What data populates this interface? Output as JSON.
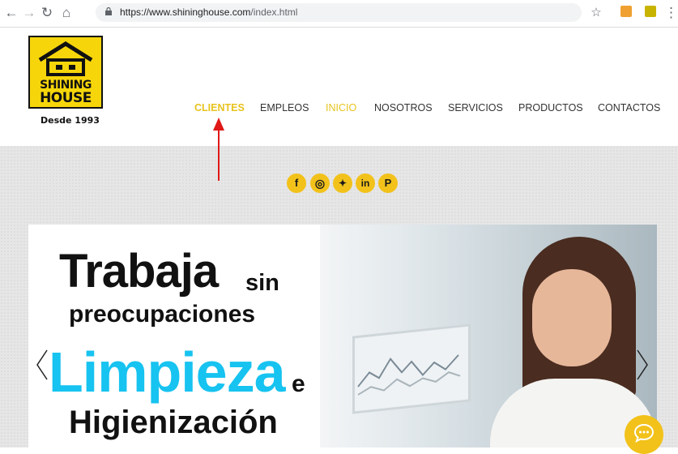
{
  "browser": {
    "url_host": "https://www.shininghouse.com",
    "url_path": "/index.html"
  },
  "logo": {
    "line1": "SHINING",
    "line2": "HOUSE",
    "since": "Desde 1993"
  },
  "nav": {
    "items": [
      {
        "label": "CLIENTES",
        "state": "active-bold"
      },
      {
        "label": "EMPLEOS",
        "state": "normal"
      },
      {
        "label": "INICIO",
        "state": "active"
      },
      {
        "label": "NOSOTROS",
        "state": "normal"
      },
      {
        "label": "SERVICIOS",
        "state": "normal"
      },
      {
        "label": "PRODUCTOS",
        "state": "normal"
      },
      {
        "label": "CONTACTOS",
        "state": "normal"
      }
    ]
  },
  "social": [
    {
      "icon": "facebook-icon",
      "glyph": "f"
    },
    {
      "icon": "instagram-icon",
      "glyph": "◎"
    },
    {
      "icon": "twitter-icon",
      "glyph": "✦"
    },
    {
      "icon": "linkedin-icon",
      "glyph": "in"
    },
    {
      "icon": "pinterest-icon",
      "glyph": "P"
    }
  ],
  "hero": {
    "line1": "Trabaja",
    "line1_small": "sin",
    "line2": "preocupaciones",
    "line3": "Limpieza",
    "line3_small": "e",
    "line4": "Higienización"
  },
  "colors": {
    "accent": "#e8c31d",
    "logo_yellow": "#f6d60a",
    "highlight_blue": "#17c3f0",
    "annotation_red": "#e01818"
  }
}
